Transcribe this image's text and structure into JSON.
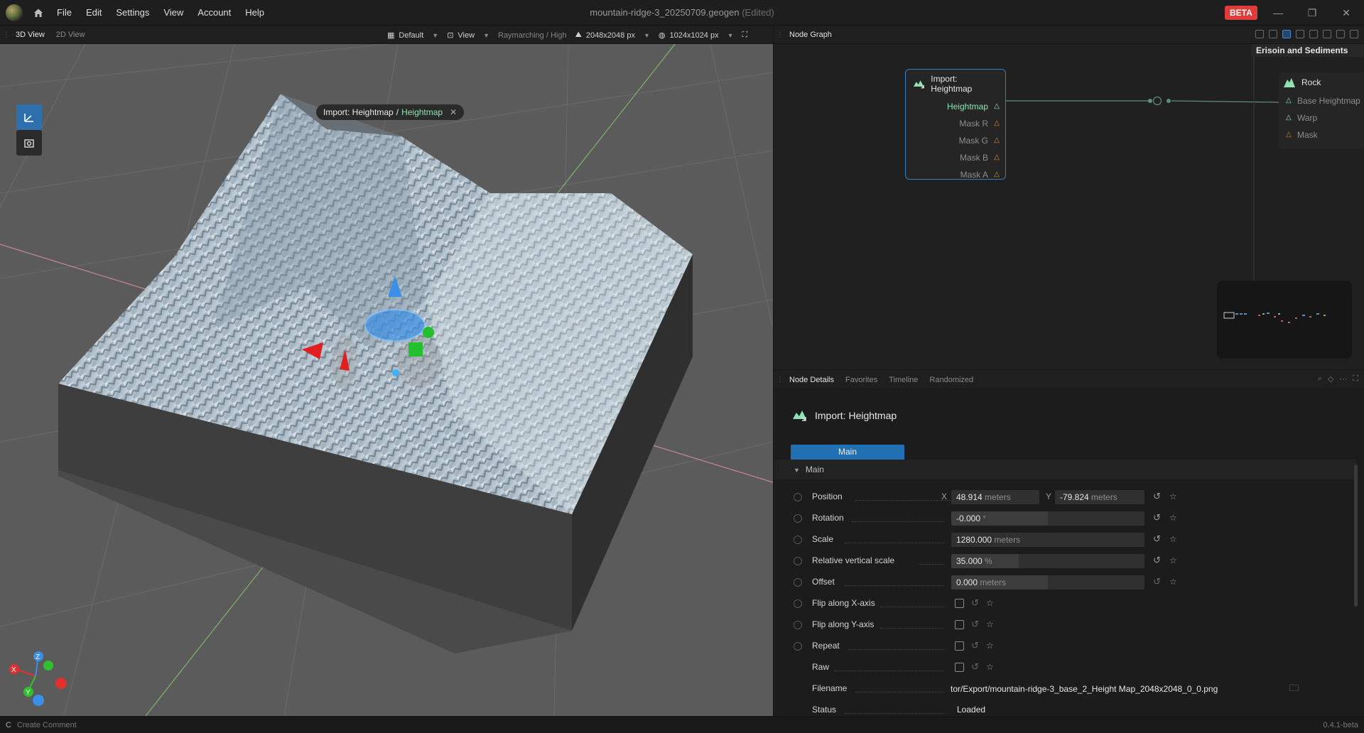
{
  "titlebar": {
    "menu": [
      "File",
      "Edit",
      "Settings",
      "View",
      "Account",
      "Help"
    ],
    "doc_title": "mountain-ridge-3_20250709.geogen",
    "doc_state": "(Edited)",
    "beta_badge": "BETA"
  },
  "viewport": {
    "tabs": [
      "3D View",
      "2D View"
    ],
    "preset": "Default",
    "view_menu": "View",
    "render_mode": "Raymarching / High",
    "resolution_a": "2048x2048 px",
    "resolution_b": "1024x1024 px",
    "selection_chip": {
      "node": "Import: Heightmap",
      "output": "Heightmap"
    },
    "axes": {
      "x": "X",
      "y": "Y",
      "z": "Z"
    }
  },
  "node_graph": {
    "title": "Node Graph",
    "group_label": "Erisoin and Sediments",
    "selected_node": {
      "title": "Import: Heightmap",
      "ports": [
        "Heightmap",
        "Mask R",
        "Mask G",
        "Mask B",
        "Mask A"
      ]
    },
    "rock_node": {
      "title": "Rock",
      "inputs": [
        "Base Heightmap",
        "Warp",
        "Mask"
      ]
    }
  },
  "details": {
    "tabs": [
      "Node Details",
      "Favorites",
      "Timeline",
      "Randomized"
    ],
    "node_title": "Import: Heightmap",
    "main_tab": "Main",
    "section": "Main",
    "position": {
      "label": "Position",
      "x_axis": "X",
      "x_value": "48.914",
      "y_axis": "Y",
      "y_value": "-79.824",
      "unit": "meters"
    },
    "rotation": {
      "label": "Rotation",
      "value": "-0.000",
      "unit": "°"
    },
    "scale": {
      "label": "Scale",
      "value": "1280.000",
      "unit": "meters"
    },
    "rel_vscale": {
      "label": "Relative vertical scale",
      "value": "35.000",
      "unit": "%"
    },
    "offset": {
      "label": "Offset",
      "value": "0.000",
      "unit": "meters"
    },
    "flip_x": {
      "label": "Flip along X-axis"
    },
    "flip_y": {
      "label": "Flip along Y-axis"
    },
    "repeat": {
      "label": "Repeat"
    },
    "raw": {
      "label": "Raw"
    },
    "filename": {
      "label": "Filename",
      "value": "tor/Export/mountain-ridge-3_base_2_Height Map_2048x2048_0_0.png"
    },
    "status": {
      "label": "Status",
      "value": "Loaded"
    }
  },
  "statusbar": {
    "key": "C",
    "hint": "Create Comment",
    "version": "0.4.1-beta"
  },
  "colors": {
    "accent_blue": "#2170b4",
    "port_green": "#8ee3b4",
    "beta_red": "#e03c3c"
  }
}
